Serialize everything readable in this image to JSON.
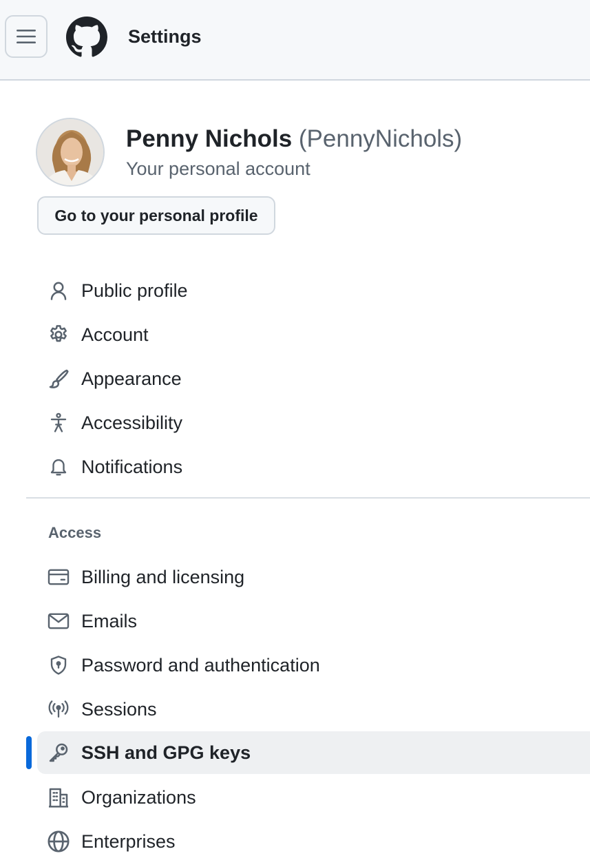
{
  "header": {
    "title": "Settings",
    "menu_icon": "hamburger-icon",
    "logo_icon": "github-logo-icon"
  },
  "user": {
    "name": "Penny Nichols",
    "handle": "(PennyNichols)",
    "subtitle": "Your personal account",
    "profile_button_label": "Go to your personal profile"
  },
  "nav": {
    "main": [
      {
        "label": "Public profile",
        "icon": "person-icon"
      },
      {
        "label": "Account",
        "icon": "gear-icon"
      },
      {
        "label": "Appearance",
        "icon": "paintbrush-icon"
      },
      {
        "label": "Accessibility",
        "icon": "accessibility-icon"
      },
      {
        "label": "Notifications",
        "icon": "bell-icon"
      }
    ],
    "access_heading": "Access",
    "access": [
      {
        "label": "Billing and licensing",
        "icon": "credit-card-icon"
      },
      {
        "label": "Emails",
        "icon": "mail-icon"
      },
      {
        "label": "Password and authentication",
        "icon": "shield-lock-icon"
      },
      {
        "label": "Sessions",
        "icon": "broadcast-icon"
      },
      {
        "label": "SSH and GPG keys",
        "icon": "key-icon",
        "active": true
      },
      {
        "label": "Organizations",
        "icon": "organization-icon"
      },
      {
        "label": "Enterprises",
        "icon": "globe-icon"
      }
    ]
  },
  "colors": {
    "accent": "#0969da",
    "text": "#1f2328",
    "muted": "#59636e",
    "border": "#d0d7de",
    "header_bg": "#f6f8fa",
    "active_bg": "#eef0f2"
  }
}
